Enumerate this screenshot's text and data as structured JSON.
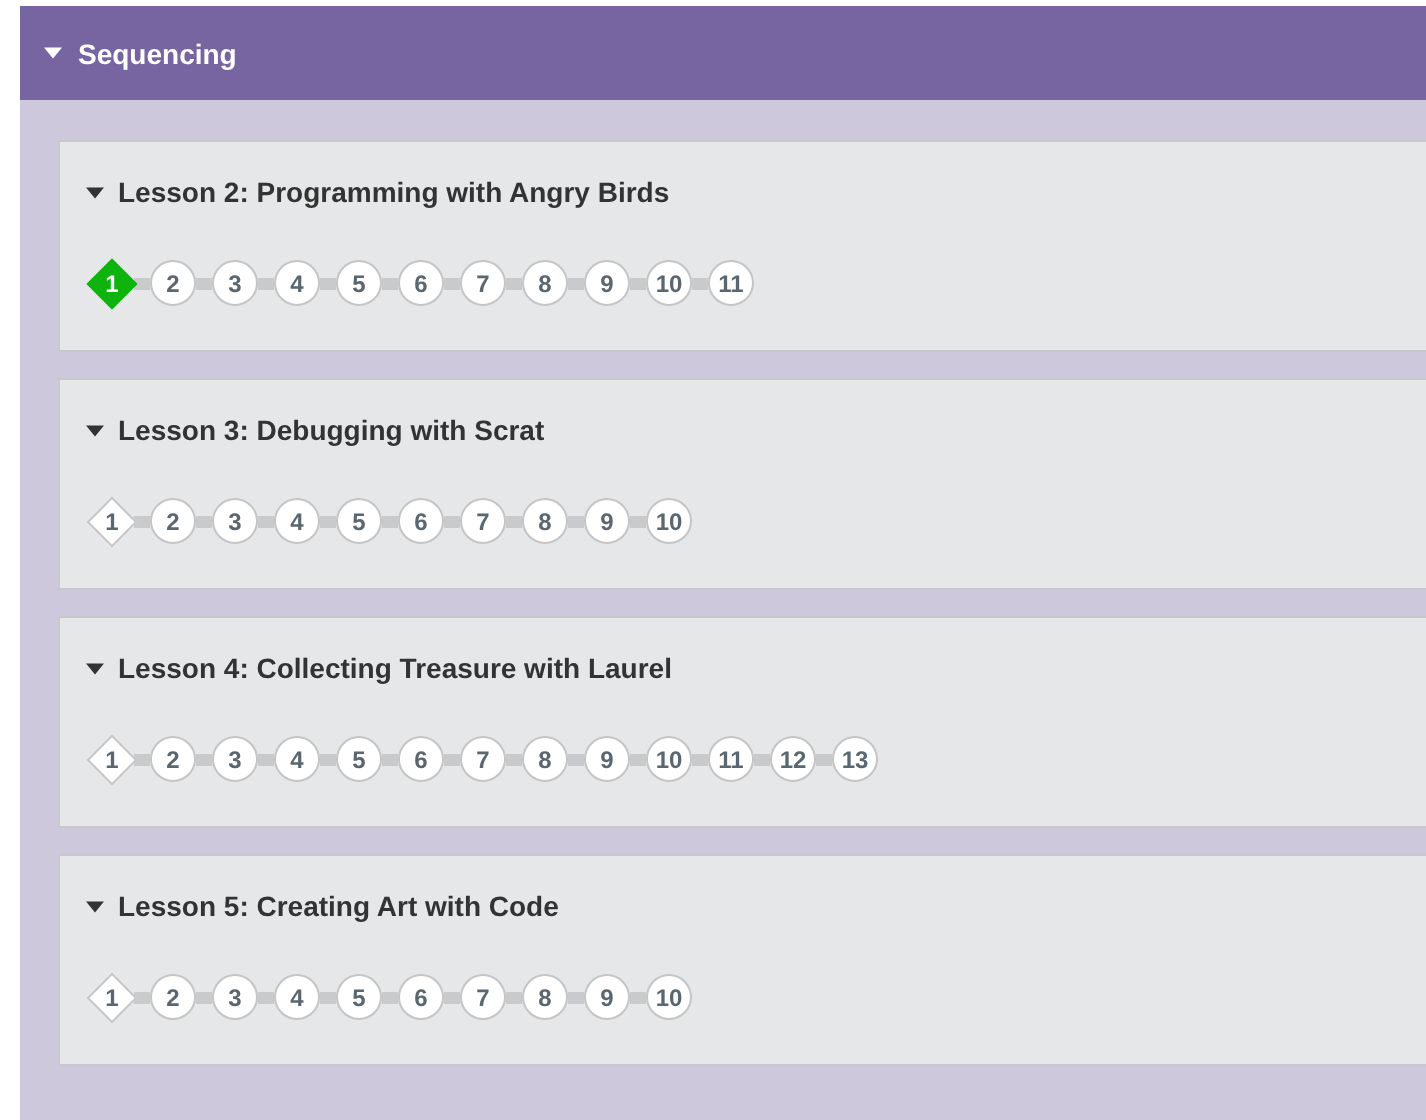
{
  "section": {
    "title": "Sequencing",
    "expanded": true
  },
  "lessons": [
    {
      "title": "Lesson 2: Programming with Angry Birds",
      "expanded": true,
      "levels": [
        {
          "label": "1",
          "kind": "diamond",
          "selected": true
        },
        {
          "label": "2",
          "kind": "circle",
          "selected": false
        },
        {
          "label": "3",
          "kind": "circle",
          "selected": false
        },
        {
          "label": "4",
          "kind": "circle",
          "selected": false
        },
        {
          "label": "5",
          "kind": "circle",
          "selected": false
        },
        {
          "label": "6",
          "kind": "circle",
          "selected": false
        },
        {
          "label": "7",
          "kind": "circle",
          "selected": false
        },
        {
          "label": "8",
          "kind": "circle",
          "selected": false
        },
        {
          "label": "9",
          "kind": "circle",
          "selected": false
        },
        {
          "label": "10",
          "kind": "circle",
          "selected": false
        },
        {
          "label": "11",
          "kind": "circle",
          "selected": false
        }
      ]
    },
    {
      "title": "Lesson 3: Debugging with Scrat",
      "expanded": true,
      "levels": [
        {
          "label": "1",
          "kind": "diamond",
          "selected": false
        },
        {
          "label": "2",
          "kind": "circle",
          "selected": false
        },
        {
          "label": "3",
          "kind": "circle",
          "selected": false
        },
        {
          "label": "4",
          "kind": "circle",
          "selected": false
        },
        {
          "label": "5",
          "kind": "circle",
          "selected": false
        },
        {
          "label": "6",
          "kind": "circle",
          "selected": false
        },
        {
          "label": "7",
          "kind": "circle",
          "selected": false
        },
        {
          "label": "8",
          "kind": "circle",
          "selected": false
        },
        {
          "label": "9",
          "kind": "circle",
          "selected": false
        },
        {
          "label": "10",
          "kind": "circle",
          "selected": false
        }
      ]
    },
    {
      "title": "Lesson 4: Collecting Treasure with Laurel",
      "expanded": true,
      "levels": [
        {
          "label": "1",
          "kind": "diamond",
          "selected": false
        },
        {
          "label": "2",
          "kind": "circle",
          "selected": false
        },
        {
          "label": "3",
          "kind": "circle",
          "selected": false
        },
        {
          "label": "4",
          "kind": "circle",
          "selected": false
        },
        {
          "label": "5",
          "kind": "circle",
          "selected": false
        },
        {
          "label": "6",
          "kind": "circle",
          "selected": false
        },
        {
          "label": "7",
          "kind": "circle",
          "selected": false
        },
        {
          "label": "8",
          "kind": "circle",
          "selected": false
        },
        {
          "label": "9",
          "kind": "circle",
          "selected": false
        },
        {
          "label": "10",
          "kind": "circle",
          "selected": false
        },
        {
          "label": "11",
          "kind": "circle",
          "selected": false
        },
        {
          "label": "12",
          "kind": "circle",
          "selected": false
        },
        {
          "label": "13",
          "kind": "circle",
          "selected": false
        }
      ]
    },
    {
      "title": "Lesson 5: Creating Art with Code",
      "expanded": true,
      "levels": [
        {
          "label": "1",
          "kind": "diamond",
          "selected": false
        },
        {
          "label": "2",
          "kind": "circle",
          "selected": false
        },
        {
          "label": "3",
          "kind": "circle",
          "selected": false
        },
        {
          "label": "4",
          "kind": "circle",
          "selected": false
        },
        {
          "label": "5",
          "kind": "circle",
          "selected": false
        },
        {
          "label": "6",
          "kind": "circle",
          "selected": false
        },
        {
          "label": "7",
          "kind": "circle",
          "selected": false
        },
        {
          "label": "8",
          "kind": "circle",
          "selected": false
        },
        {
          "label": "9",
          "kind": "circle",
          "selected": false
        },
        {
          "label": "10",
          "kind": "circle",
          "selected": false
        }
      ]
    }
  ]
}
